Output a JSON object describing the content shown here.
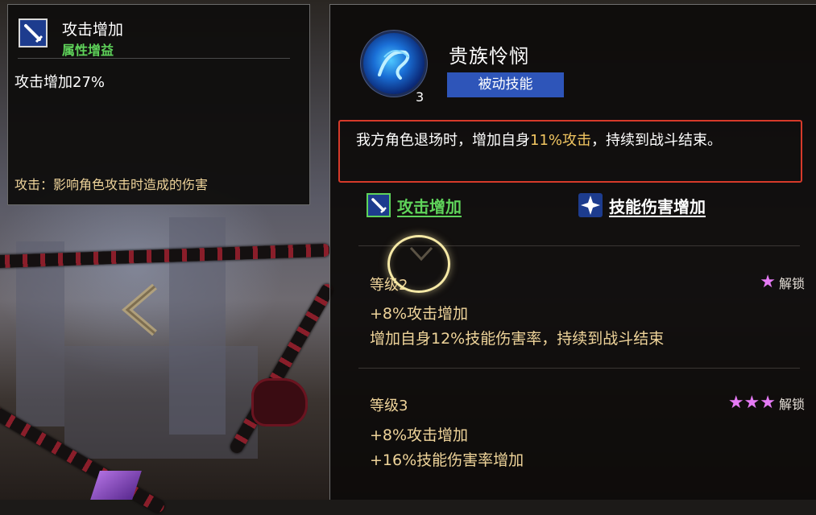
{
  "colors": {
    "accent_green": "#5fd35a",
    "gold_text": "#efd49a",
    "highlight": "#f2c661",
    "skill_type_bg": "#2e55b9",
    "star": "#e67bf5",
    "desc_box_border": "#d63a2a"
  },
  "tooltip": {
    "icon": "sword-icon",
    "title": "攻击增加",
    "subtitle": "属性增益",
    "value": "攻击增加27%",
    "description": "攻击：影响角色攻击时造成的伤害"
  },
  "skill": {
    "icon": "skill-swirl-icon",
    "level": "3",
    "name": "贵族怜悯",
    "type": "被动技能",
    "description": {
      "part1": "我方角色退场时，增加自身",
      "highlight": "11%攻击",
      "part2": "，持续到战斗结束。"
    },
    "tags": [
      {
        "icon": "sword-icon",
        "label": "攻击增加"
      },
      {
        "icon": "sparkle-icon",
        "label": "技能伤害增加"
      }
    ],
    "levels": [
      {
        "title": "等级2",
        "stars": 1,
        "star_display": "★",
        "unlock_label": "解锁",
        "effects": [
          "+8%攻击增加",
          "增加自身12%技能伤害率，持续到战斗结束"
        ]
      },
      {
        "title": "等级3",
        "stars": 3,
        "star_display": "★★★",
        "unlock_label": "解锁",
        "effects": [
          "+8%攻击增加",
          "+16%技能伤害率增加"
        ]
      }
    ]
  }
}
